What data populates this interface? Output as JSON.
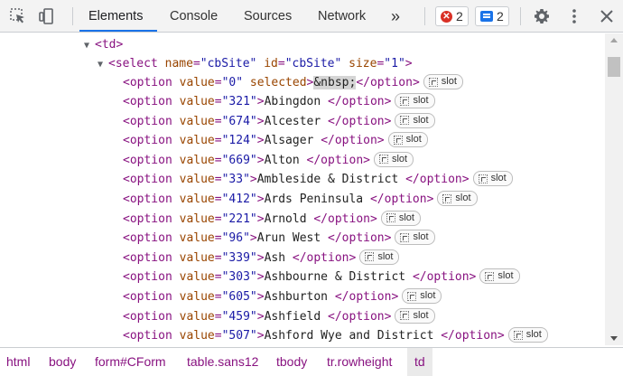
{
  "toolbar": {
    "tabs": [
      "Elements",
      "Console",
      "Sources",
      "Network"
    ],
    "more": "»",
    "errors_count": "2",
    "messages_count": "2"
  },
  "dom": {
    "td_open": "<td>",
    "select_tag": "select",
    "select_attrs": [
      {
        "name": "name",
        "value": "\"cbSite\""
      },
      {
        "name": "id",
        "value": "\"cbSite\""
      },
      {
        "name": "size",
        "value": "\"1\""
      }
    ],
    "first_option": {
      "value": "\"0\"",
      "selected": "selected",
      "text": "&nbsp;"
    },
    "options": [
      {
        "value": "\"321\"",
        "text": "Abingdon "
      },
      {
        "value": "\"674\"",
        "text": "Alcester "
      },
      {
        "value": "\"124\"",
        "text": "Alsager "
      },
      {
        "value": "\"669\"",
        "text": "Alton "
      },
      {
        "value": "\"33\"",
        "text": "Ambleside & District "
      },
      {
        "value": "\"412\"",
        "text": "Ards Peninsula "
      },
      {
        "value": "\"221\"",
        "text": "Arnold "
      },
      {
        "value": "\"96\"",
        "text": "Arun West "
      },
      {
        "value": "\"339\"",
        "text": "Ash "
      },
      {
        "value": "\"303\"",
        "text": "Ashbourne & District "
      },
      {
        "value": "\"605\"",
        "text": "Ashburton "
      },
      {
        "value": "\"459\"",
        "text": "Ashfield "
      },
      {
        "value": "\"507\"",
        "text": "Ashford Wye and District "
      }
    ],
    "slot_label": "slot"
  },
  "breadcrumbs": [
    "html",
    "body",
    "form#CForm",
    "table.sans12",
    "tbody",
    "tr.rowheight",
    "td"
  ]
}
